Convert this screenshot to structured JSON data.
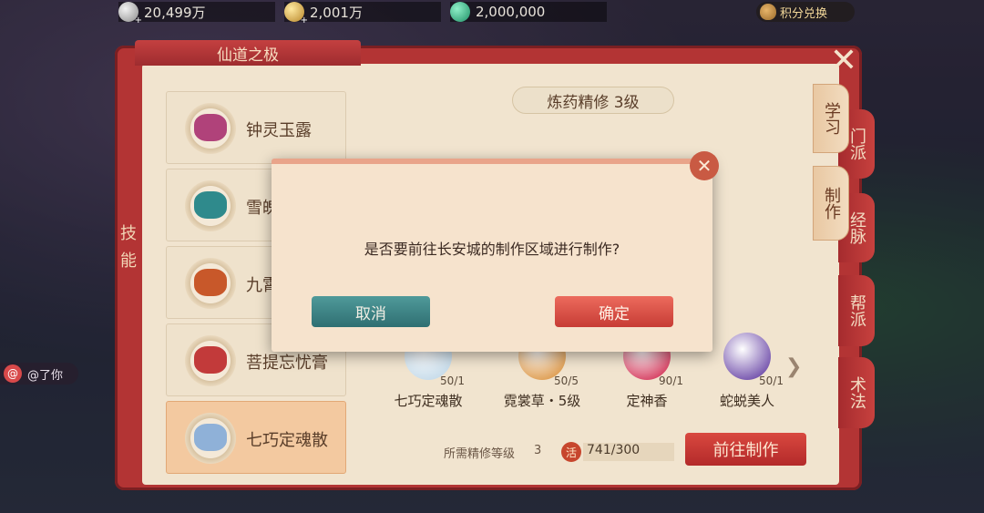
{
  "currencies": {
    "silver": "20,499万",
    "gold": "2,001万",
    "jade": "2,000,000"
  },
  "points_button": "积分兑换",
  "panel": {
    "title": "仙道之极",
    "rail_label": "技能"
  },
  "skills": [
    {
      "name": "钟灵玉露",
      "selected": false,
      "color": "#b0427a"
    },
    {
      "name": "雪魄",
      "selected": false,
      "color": "#2f8a8c"
    },
    {
      "name": "九霄",
      "selected": false,
      "color": "#c8582a"
    },
    {
      "name": "菩提忘忧膏",
      "selected": false,
      "color": "#c23a3a"
    },
    {
      "name": "七巧定魂散",
      "selected": true,
      "color": "#8fb1d8"
    }
  ],
  "level_title": "炼药精修 3级",
  "recipes": [
    {
      "name": "七巧定魂散",
      "qty": "50/1",
      "color": "#c9ddeb"
    },
    {
      "name": "霓裳草・5级",
      "qty": "50/5",
      "color": "#e0a25a"
    },
    {
      "name": "定神香",
      "qty": "90/1",
      "color": "#d84a6a"
    },
    {
      "name": "蛇蜕美人",
      "qty": "50/1",
      "color": "#7a5ab0"
    }
  ],
  "requirement": {
    "label": "所需精修等级",
    "level": "3",
    "seal_char": "活",
    "vitality": "741/300"
  },
  "go_make_button": "前往制作",
  "side_tabs": [
    {
      "label": "学习",
      "active": false
    },
    {
      "label": "门派",
      "active": false
    },
    {
      "label": "制作",
      "active": true
    },
    {
      "label": "经脉",
      "active": false
    },
    {
      "label": "帮派",
      "active": false
    },
    {
      "label": "术法",
      "active": false
    }
  ],
  "close_symbol": "✕",
  "dialog": {
    "message": "是否要前往长安城的制作区域进行制作?",
    "cancel": "取消",
    "confirm": "确定",
    "close_symbol": "✕"
  },
  "chat": {
    "at": "@",
    "text": "@了你"
  },
  "colors": {
    "panel_red": "#b33434",
    "parchment": "#f1e4cf",
    "confirm_red": "#c73c35",
    "cancel_teal": "#2f6f72"
  }
}
